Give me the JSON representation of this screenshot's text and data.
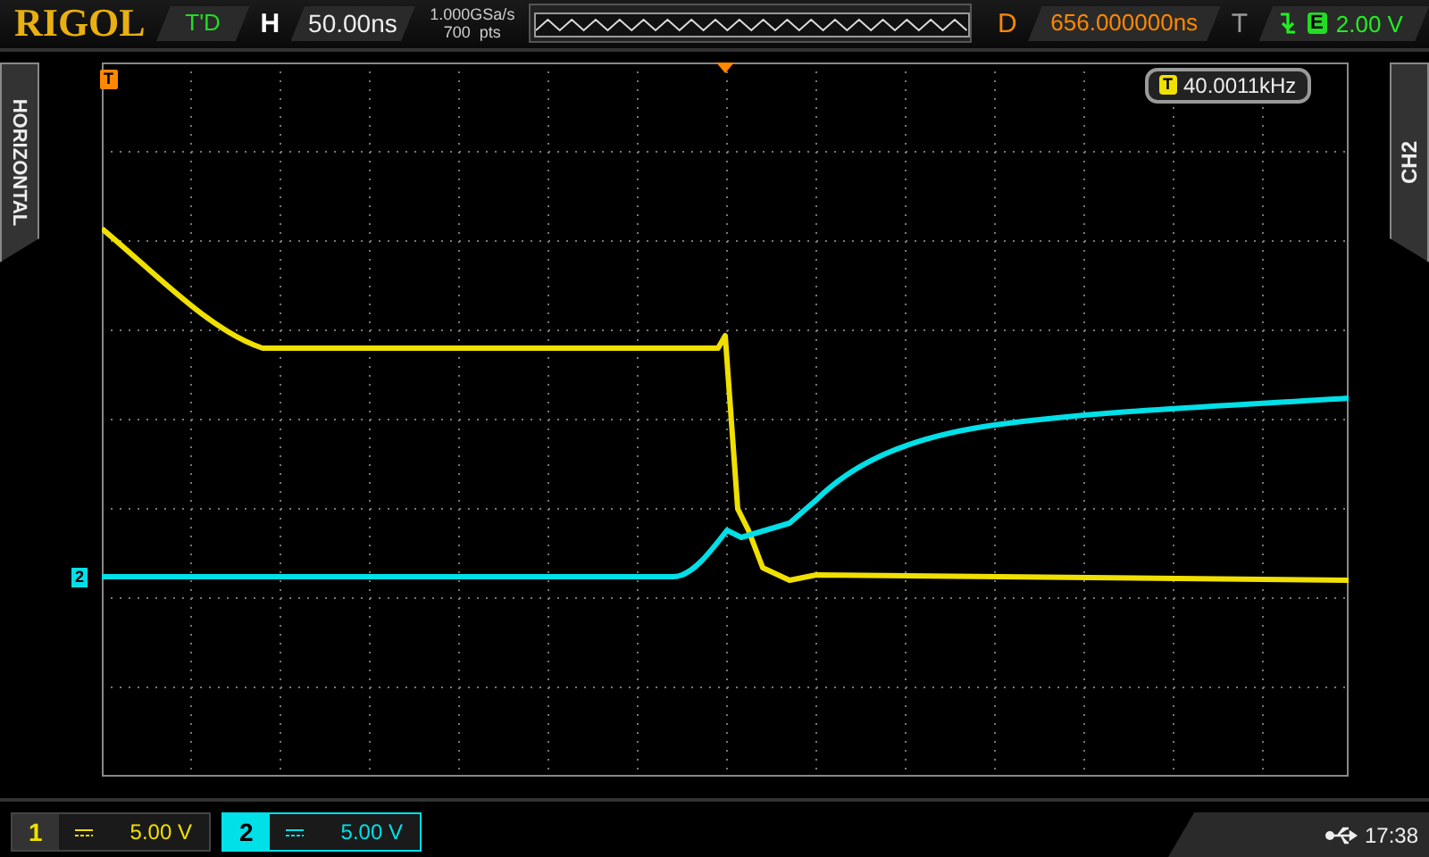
{
  "header": {
    "logo": "RIGOL",
    "run_status": "T'D",
    "horizontal_label": "H",
    "timebase": "50.00ns",
    "sample_rate": "1.000GSa/s",
    "memory_depth": "700  pts",
    "delay_label": "D",
    "delay": "656.000000ns",
    "trigger_label": "T",
    "trigger_source": "E",
    "trigger_level": "2.00 V"
  },
  "side_left": {
    "label": "HORIZONTAL"
  },
  "side_right": {
    "label": "CH2"
  },
  "trigger_marker": "T",
  "counter": {
    "badge": "T",
    "value": "40.0011kHz"
  },
  "channel_marker": "2",
  "channels": [
    {
      "number": "1",
      "scale": "5.00 V",
      "selected": false,
      "color": "#f0e000"
    },
    {
      "number": "2",
      "scale": "5.00 V",
      "selected": true,
      "color": "#00e0e8"
    }
  ],
  "status_bar": {
    "time": "17:38"
  }
}
